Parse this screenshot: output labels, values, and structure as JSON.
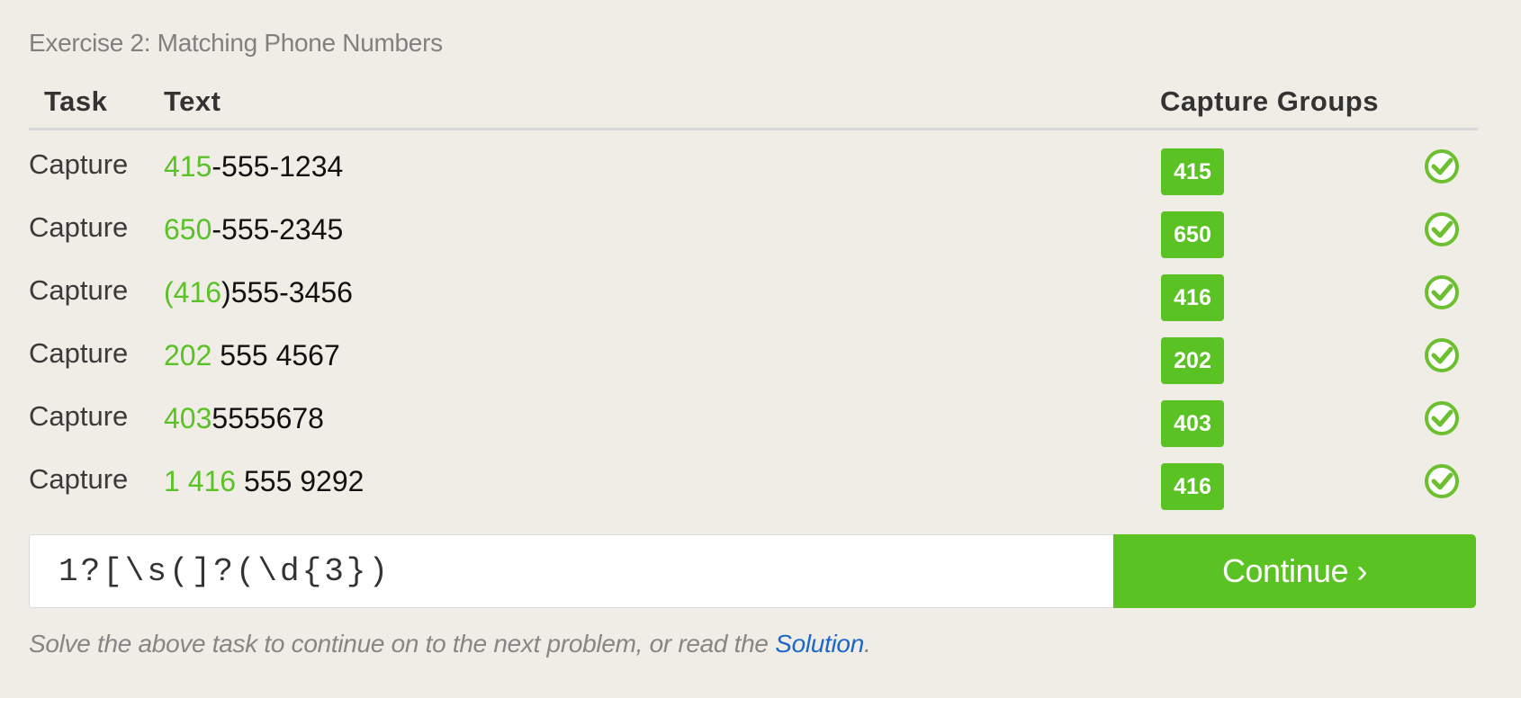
{
  "exercise": {
    "title": "Exercise 2: Matching Phone Numbers"
  },
  "table": {
    "headers": {
      "task": "Task",
      "text": "Text",
      "capture_groups": "Capture Groups"
    },
    "rows": [
      {
        "task": "Capture",
        "match": "415",
        "rest": "-555-1234",
        "group": "415",
        "status_icon": "check-circle-icon"
      },
      {
        "task": "Capture",
        "match": "650",
        "rest": "-555-2345",
        "group": "650",
        "status_icon": "check-circle-icon"
      },
      {
        "task": "Capture",
        "match": "(416",
        "rest": ")555-3456",
        "group": "416",
        "status_icon": "check-circle-icon"
      },
      {
        "task": "Capture",
        "match": "202",
        "rest": " 555 4567",
        "group": "202",
        "status_icon": "check-circle-icon"
      },
      {
        "task": "Capture",
        "match": "403",
        "rest": "5555678",
        "group": "403",
        "status_icon": "check-circle-icon"
      },
      {
        "task": "Capture",
        "match": "1 416",
        "rest": " 555 9292",
        "group": "416",
        "status_icon": "check-circle-icon"
      }
    ]
  },
  "regex_input": {
    "value": "1?[\\s(]?(\\d{3})"
  },
  "continue_button": {
    "label": "Continue ›"
  },
  "help": {
    "text": "Solve the above task to continue on to the next problem, or read the ",
    "link_label": "Solution",
    "trailing": "."
  },
  "colors": {
    "accent_green": "#5ac222",
    "link_blue": "#1c68c8",
    "panel_bg": "#efede6"
  }
}
